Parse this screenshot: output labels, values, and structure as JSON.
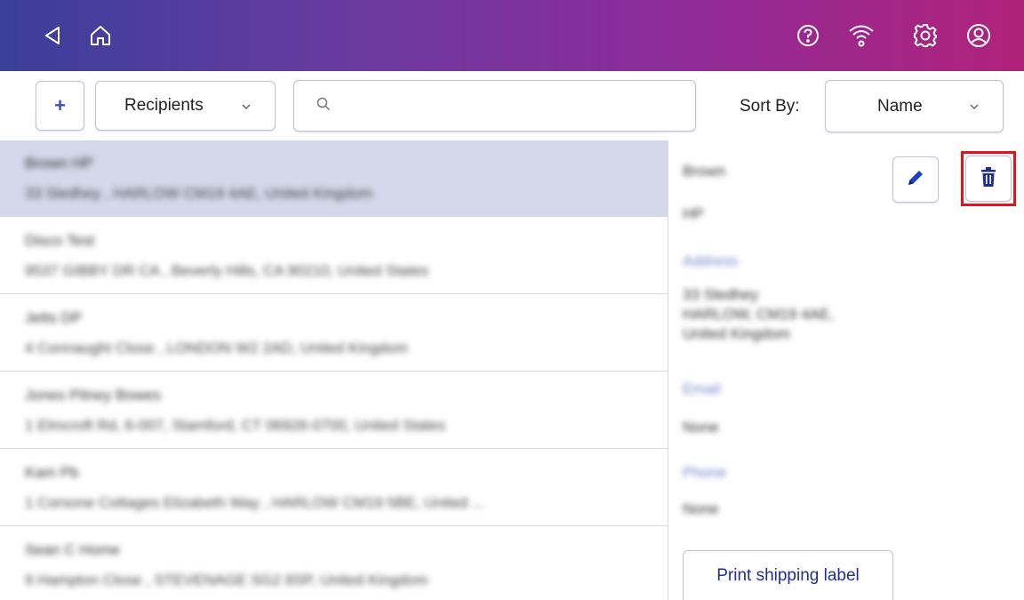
{
  "topbar": {
    "back_icon": "back-arrow-icon",
    "home_icon": "home-icon",
    "help_icon": "help-icon",
    "wifi_icon": "wifi-icon",
    "settings_icon": "gear-icon",
    "account_icon": "account-icon",
    "gradient": [
      "#3a3f9a",
      "#8e2c9b",
      "#b0227a"
    ]
  },
  "toolbar": {
    "add_label": "+",
    "category_label": "Recipients",
    "search_placeholder": "",
    "sort_by_label": "Sort By:",
    "sort_value": "Name"
  },
  "recipients": [
    {
      "name": "Brown HP",
      "address": "33 Sledhey , HARLOW CM19 4AE, United Kingdom",
      "selected": true
    },
    {
      "name": "Disco Test",
      "address": "9537 GIBBY DR CA , Beverly Hills, CA 90210, United States",
      "selected": false
    },
    {
      "name": "Jetts DP",
      "address": "4 Connaught Close , LONDON W2 2AD, United Kingdom",
      "selected": false
    },
    {
      "name": "Jones Pitney Bowes",
      "address": "1 Elmcroft Rd, 6-007, Stamford, CT 06926-0700, United States",
      "selected": false
    },
    {
      "name": "Kam Pb",
      "address": "1 Corsone Cottages Elizabeth Way , HARLOW CM19 5BE, United ...",
      "selected": false
    },
    {
      "name": "Sean C Home",
      "address": "9 Hampton Close , STEVENAGE SG2 8SP, United Kingdom",
      "selected": false
    }
  ],
  "detail": {
    "last_name": "Brown",
    "first_name": "HP",
    "address_label": "Address",
    "address_lines": [
      "33 Sledhey",
      "HARLOW, CM19 4AE,",
      "United Kingdom"
    ],
    "email_label": "Email",
    "email_value": "None",
    "phone_label": "Phone",
    "phone_value": "None",
    "edit_icon": "pencil-icon",
    "delete_icon": "trash-icon",
    "print_label": "Print shipping label",
    "highlight_color": "#e0141e",
    "accent_color": "#1f2f8f"
  }
}
